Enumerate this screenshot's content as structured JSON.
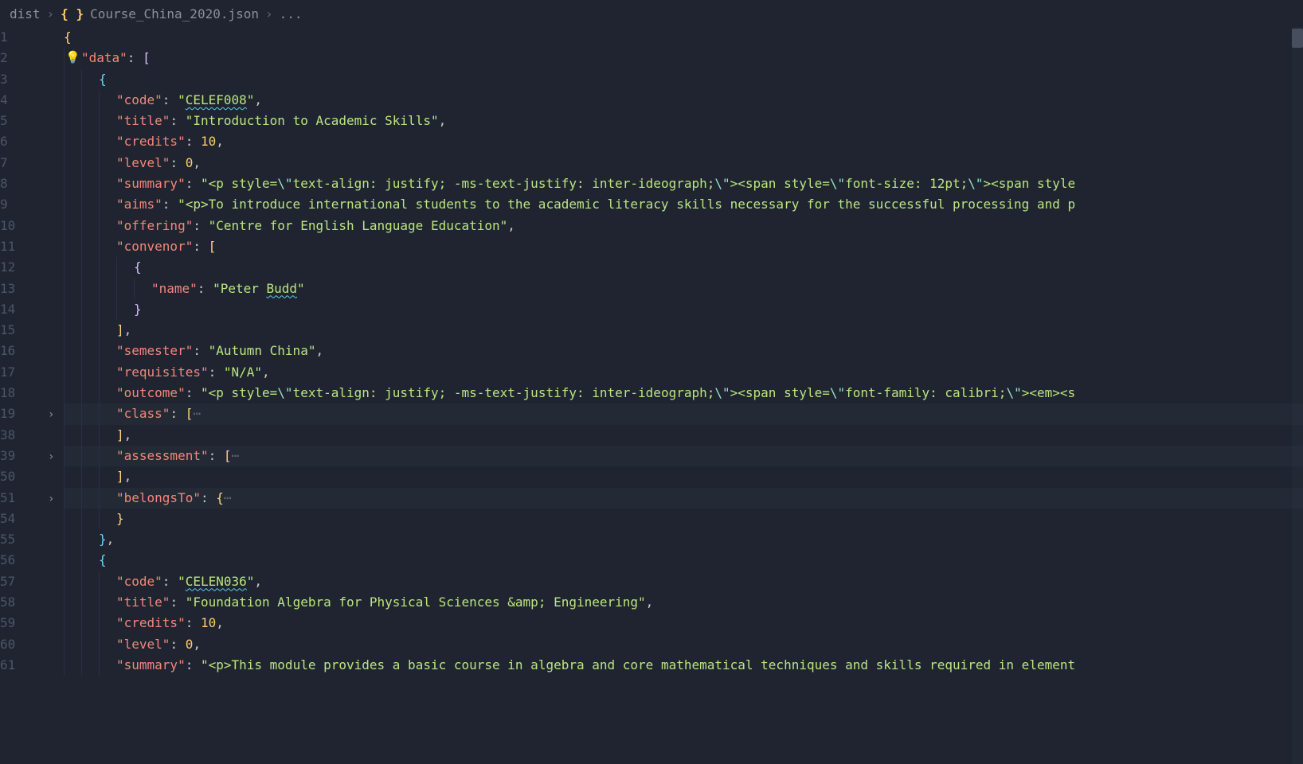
{
  "breadcrumb": {
    "folder": "dist",
    "file": "Course_China_2020.json",
    "tail": "..."
  },
  "lines": [
    {
      "n": 1,
      "indent": 0,
      "tokens": [
        {
          "t": "{",
          "c": "brace-y"
        }
      ]
    },
    {
      "n": 2,
      "indent": 1,
      "bulb": true,
      "tokens": [
        {
          "t": "\"data\"",
          "c": "key"
        },
        {
          "t": ": ",
          "c": "punc"
        },
        {
          "t": "[",
          "c": "brace-p"
        }
      ]
    },
    {
      "n": 3,
      "indent": 2,
      "tokens": [
        {
          "t": "{",
          "c": "brace-b"
        }
      ]
    },
    {
      "n": 4,
      "indent": 3,
      "tokens": [
        {
          "t": "\"code\"",
          "c": "key"
        },
        {
          "t": ": ",
          "c": "punc"
        },
        {
          "t": "\"",
          "c": "str"
        },
        {
          "t": "CELEF008",
          "c": "str squiggle"
        },
        {
          "t": "\"",
          "c": "str"
        },
        {
          "t": ",",
          "c": "punc"
        }
      ]
    },
    {
      "n": 5,
      "indent": 3,
      "tokens": [
        {
          "t": "\"title\"",
          "c": "key"
        },
        {
          "t": ": ",
          "c": "punc"
        },
        {
          "t": "\"Introduction to Academic Skills\"",
          "c": "str"
        },
        {
          "t": ",",
          "c": "punc"
        }
      ]
    },
    {
      "n": 6,
      "indent": 3,
      "tokens": [
        {
          "t": "\"credits\"",
          "c": "key"
        },
        {
          "t": ": ",
          "c": "punc"
        },
        {
          "t": "10",
          "c": "num"
        },
        {
          "t": ",",
          "c": "punc"
        }
      ]
    },
    {
      "n": 7,
      "indent": 3,
      "tokens": [
        {
          "t": "\"level\"",
          "c": "key"
        },
        {
          "t": ": ",
          "c": "punc"
        },
        {
          "t": "0",
          "c": "num"
        },
        {
          "t": ",",
          "c": "punc"
        }
      ]
    },
    {
      "n": 8,
      "indent": 3,
      "tokens": [
        {
          "t": "\"summary\"",
          "c": "key"
        },
        {
          "t": ": ",
          "c": "punc"
        },
        {
          "t": "\"<p style=",
          "c": "str"
        },
        {
          "t": "\\\"",
          "c": "esc"
        },
        {
          "t": "text-align: justify; -ms-text-justify: inter-ideograph;",
          "c": "str"
        },
        {
          "t": "\\\"",
          "c": "esc"
        },
        {
          "t": "><span style=",
          "c": "str"
        },
        {
          "t": "\\\"",
          "c": "esc"
        },
        {
          "t": "font-size: 12pt;",
          "c": "str"
        },
        {
          "t": "\\\"",
          "c": "esc"
        },
        {
          "t": "><span style",
          "c": "str"
        }
      ]
    },
    {
      "n": 9,
      "indent": 3,
      "tokens": [
        {
          "t": "\"aims\"",
          "c": "key"
        },
        {
          "t": ": ",
          "c": "punc"
        },
        {
          "t": "\"<p>To introduce international students to the academic literacy skills necessary for the successful processing and p",
          "c": "str"
        }
      ]
    },
    {
      "n": 10,
      "indent": 3,
      "tokens": [
        {
          "t": "\"offering\"",
          "c": "key"
        },
        {
          "t": ": ",
          "c": "punc"
        },
        {
          "t": "\"Centre for English Language Education\"",
          "c": "str"
        },
        {
          "t": ",",
          "c": "punc"
        }
      ]
    },
    {
      "n": 11,
      "indent": 3,
      "tokens": [
        {
          "t": "\"convenor\"",
          "c": "key"
        },
        {
          "t": ": ",
          "c": "punc"
        },
        {
          "t": "[",
          "c": "brace-y"
        }
      ]
    },
    {
      "n": 12,
      "indent": 4,
      "tokens": [
        {
          "t": "{",
          "c": "brace-p"
        }
      ]
    },
    {
      "n": 13,
      "indent": 5,
      "tokens": [
        {
          "t": "\"name\"",
          "c": "key"
        },
        {
          "t": ": ",
          "c": "punc"
        },
        {
          "t": "\"Peter ",
          "c": "str"
        },
        {
          "t": "Budd",
          "c": "str squiggle"
        },
        {
          "t": "\"",
          "c": "str"
        }
      ]
    },
    {
      "n": 14,
      "indent": 4,
      "tokens": [
        {
          "t": "}",
          "c": "brace-p"
        }
      ]
    },
    {
      "n": 15,
      "indent": 3,
      "tokens": [
        {
          "t": "]",
          "c": "brace-y"
        },
        {
          "t": ",",
          "c": "punc"
        }
      ]
    },
    {
      "n": 16,
      "indent": 3,
      "tokens": [
        {
          "t": "\"semester\"",
          "c": "key"
        },
        {
          "t": ": ",
          "c": "punc"
        },
        {
          "t": "\"Autumn China\"",
          "c": "str"
        },
        {
          "t": ",",
          "c": "punc"
        }
      ]
    },
    {
      "n": 17,
      "indent": 3,
      "tokens": [
        {
          "t": "\"requisites\"",
          "c": "key"
        },
        {
          "t": ": ",
          "c": "punc"
        },
        {
          "t": "\"N/A\"",
          "c": "str"
        },
        {
          "t": ",",
          "c": "punc"
        }
      ]
    },
    {
      "n": 18,
      "indent": 3,
      "tokens": [
        {
          "t": "\"outcome\"",
          "c": "key"
        },
        {
          "t": ": ",
          "c": "punc"
        },
        {
          "t": "\"<p style=",
          "c": "str"
        },
        {
          "t": "\\\"",
          "c": "esc"
        },
        {
          "t": "text-align: justify; -ms-text-justify: inter-ideograph;",
          "c": "str"
        },
        {
          "t": "\\\"",
          "c": "esc"
        },
        {
          "t": "><span style=",
          "c": "str"
        },
        {
          "t": "\\\"",
          "c": "esc"
        },
        {
          "t": "font-family: calibri;",
          "c": "str"
        },
        {
          "t": "\\\"",
          "c": "esc"
        },
        {
          "t": "><em><s",
          "c": "str"
        }
      ]
    },
    {
      "n": 19,
      "indent": 3,
      "fold": true,
      "folded": true,
      "tokens": [
        {
          "t": "\"class\"",
          "c": "key"
        },
        {
          "t": ": ",
          "c": "punc"
        },
        {
          "t": "[",
          "c": "brace-y"
        },
        {
          "t": "⋯",
          "c": "fold-dots"
        }
      ]
    },
    {
      "n": 38,
      "indent": 3,
      "tokens": [
        {
          "t": "]",
          "c": "brace-y"
        },
        {
          "t": ",",
          "c": "punc"
        }
      ]
    },
    {
      "n": 39,
      "indent": 3,
      "fold": true,
      "folded": true,
      "tokens": [
        {
          "t": "\"assessment\"",
          "c": "key"
        },
        {
          "t": ": ",
          "c": "punc"
        },
        {
          "t": "[",
          "c": "brace-y"
        },
        {
          "t": "⋯",
          "c": "fold-dots"
        }
      ]
    },
    {
      "n": 50,
      "indent": 3,
      "tokens": [
        {
          "t": "]",
          "c": "brace-y"
        },
        {
          "t": ",",
          "c": "punc"
        }
      ]
    },
    {
      "n": 51,
      "indent": 3,
      "fold": true,
      "folded": true,
      "tokens": [
        {
          "t": "\"belongsTo\"",
          "c": "key"
        },
        {
          "t": ": ",
          "c": "punc"
        },
        {
          "t": "{",
          "c": "brace-y"
        },
        {
          "t": "⋯",
          "c": "fold-dots"
        }
      ]
    },
    {
      "n": 54,
      "indent": 3,
      "tokens": [
        {
          "t": "}",
          "c": "brace-y"
        }
      ]
    },
    {
      "n": 55,
      "indent": 2,
      "tokens": [
        {
          "t": "}",
          "c": "brace-b"
        },
        {
          "t": ",",
          "c": "punc"
        }
      ]
    },
    {
      "n": 56,
      "indent": 2,
      "tokens": [
        {
          "t": "{",
          "c": "brace-b"
        }
      ]
    },
    {
      "n": 57,
      "indent": 3,
      "tokens": [
        {
          "t": "\"code\"",
          "c": "key"
        },
        {
          "t": ": ",
          "c": "punc"
        },
        {
          "t": "\"",
          "c": "str"
        },
        {
          "t": "CELEN036",
          "c": "str squiggle"
        },
        {
          "t": "\"",
          "c": "str"
        },
        {
          "t": ",",
          "c": "punc"
        }
      ]
    },
    {
      "n": 58,
      "indent": 3,
      "tokens": [
        {
          "t": "\"title\"",
          "c": "key"
        },
        {
          "t": ": ",
          "c": "punc"
        },
        {
          "t": "\"Foundation Algebra for Physical Sciences &amp; Engineering\"",
          "c": "str"
        },
        {
          "t": ",",
          "c": "punc"
        }
      ]
    },
    {
      "n": 59,
      "indent": 3,
      "tokens": [
        {
          "t": "\"credits\"",
          "c": "key"
        },
        {
          "t": ": ",
          "c": "punc"
        },
        {
          "t": "10",
          "c": "num"
        },
        {
          "t": ",",
          "c": "punc"
        }
      ]
    },
    {
      "n": 60,
      "indent": 3,
      "tokens": [
        {
          "t": "\"level\"",
          "c": "key"
        },
        {
          "t": ": ",
          "c": "punc"
        },
        {
          "t": "0",
          "c": "num"
        },
        {
          "t": ",",
          "c": "punc"
        }
      ]
    },
    {
      "n": 61,
      "indent": 3,
      "partial": true,
      "tokens": [
        {
          "t": "\"summary\"",
          "c": "key"
        },
        {
          "t": ": ",
          "c": "punc"
        },
        {
          "t": "\"<p>This module provides a basic course in algebra and core mathematical techniques and skills required in element",
          "c": "str"
        }
      ]
    }
  ]
}
